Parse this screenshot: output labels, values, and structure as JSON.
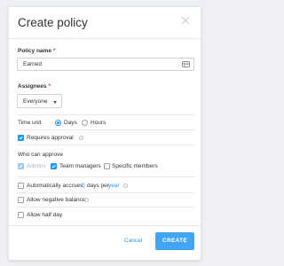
{
  "dialog": {
    "title": "Create policy",
    "close_icon": "close-icon"
  },
  "policy_name": {
    "label": "Policy name",
    "required_mark": "*",
    "value": "Earned",
    "icon": "id-card-icon"
  },
  "assignees": {
    "label": "Assignees",
    "required_mark": "*",
    "selected": "Everyone",
    "icon": "chevron-down-icon"
  },
  "time_unit": {
    "label": "Time unit",
    "options": [
      {
        "label": "Days",
        "selected": true
      },
      {
        "label": "Hours",
        "selected": false
      }
    ]
  },
  "requires_approval": {
    "label": "Requires approval",
    "checked": true
  },
  "approvers": {
    "label": "Who can approve",
    "options": [
      {
        "label": "Admins",
        "checked": true,
        "disabled": true
      },
      {
        "label": "Team managers",
        "checked": true,
        "disabled": false
      },
      {
        "label": "Specific members",
        "checked": false,
        "disabled": false
      }
    ]
  },
  "accrual": {
    "label": "Automatically accrues",
    "value": "0",
    "unit_text": "days per",
    "period": "year",
    "checked": false
  },
  "negative_balance": {
    "label": "Allow negative balance",
    "checked": false
  },
  "half_day": {
    "label": "Allow half day",
    "checked": false
  },
  "footer": {
    "cancel_label": "Cancel",
    "create_label": "CREATE"
  },
  "colors": {
    "accent": "#2196f3",
    "create_button": "#42a5f5",
    "required": "#e53935"
  }
}
